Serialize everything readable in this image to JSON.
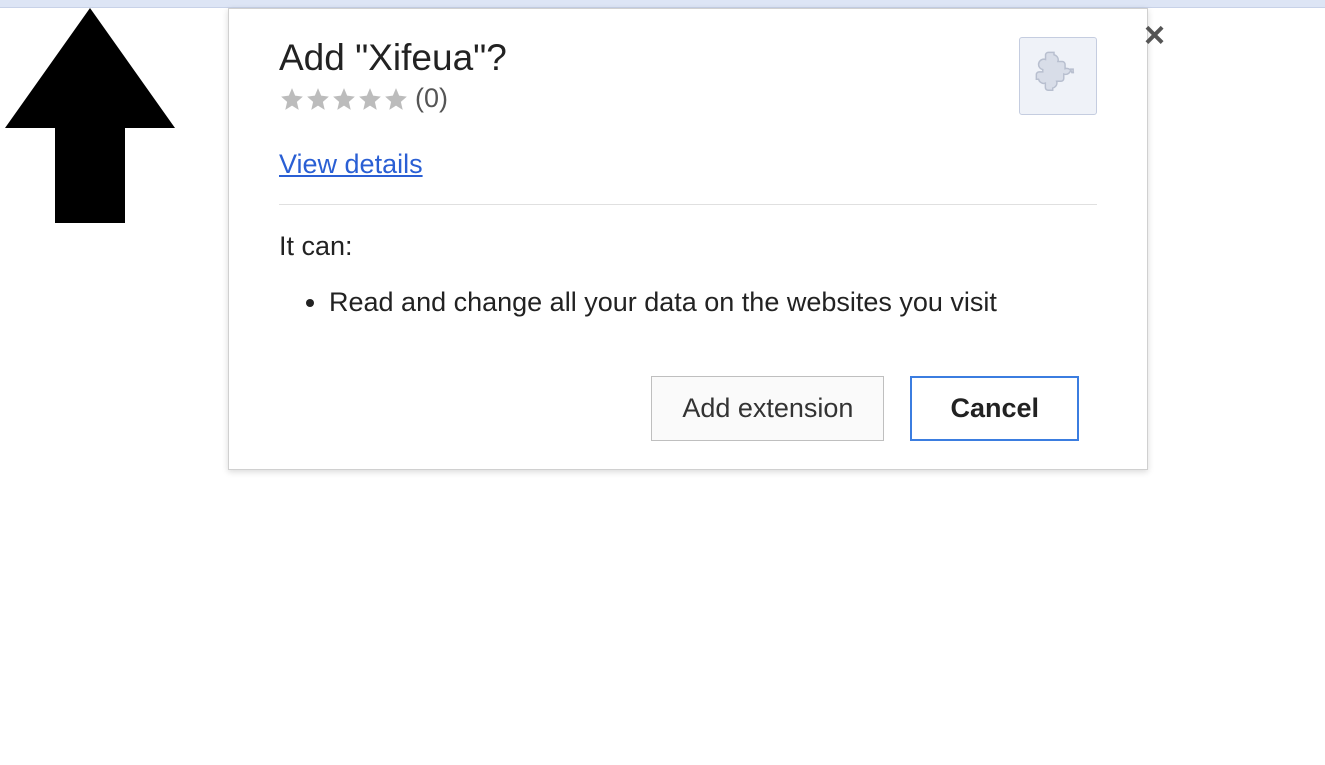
{
  "dialog": {
    "title": "Add \"Xifeua\"?",
    "rating_count": "(0)",
    "view_details": "View details",
    "permissions_heading": "It can:",
    "permissions": [
      "Read and change all your data on the websites you visit"
    ],
    "add_button": "Add extension",
    "cancel_button": "Cancel",
    "close_label": "×"
  }
}
